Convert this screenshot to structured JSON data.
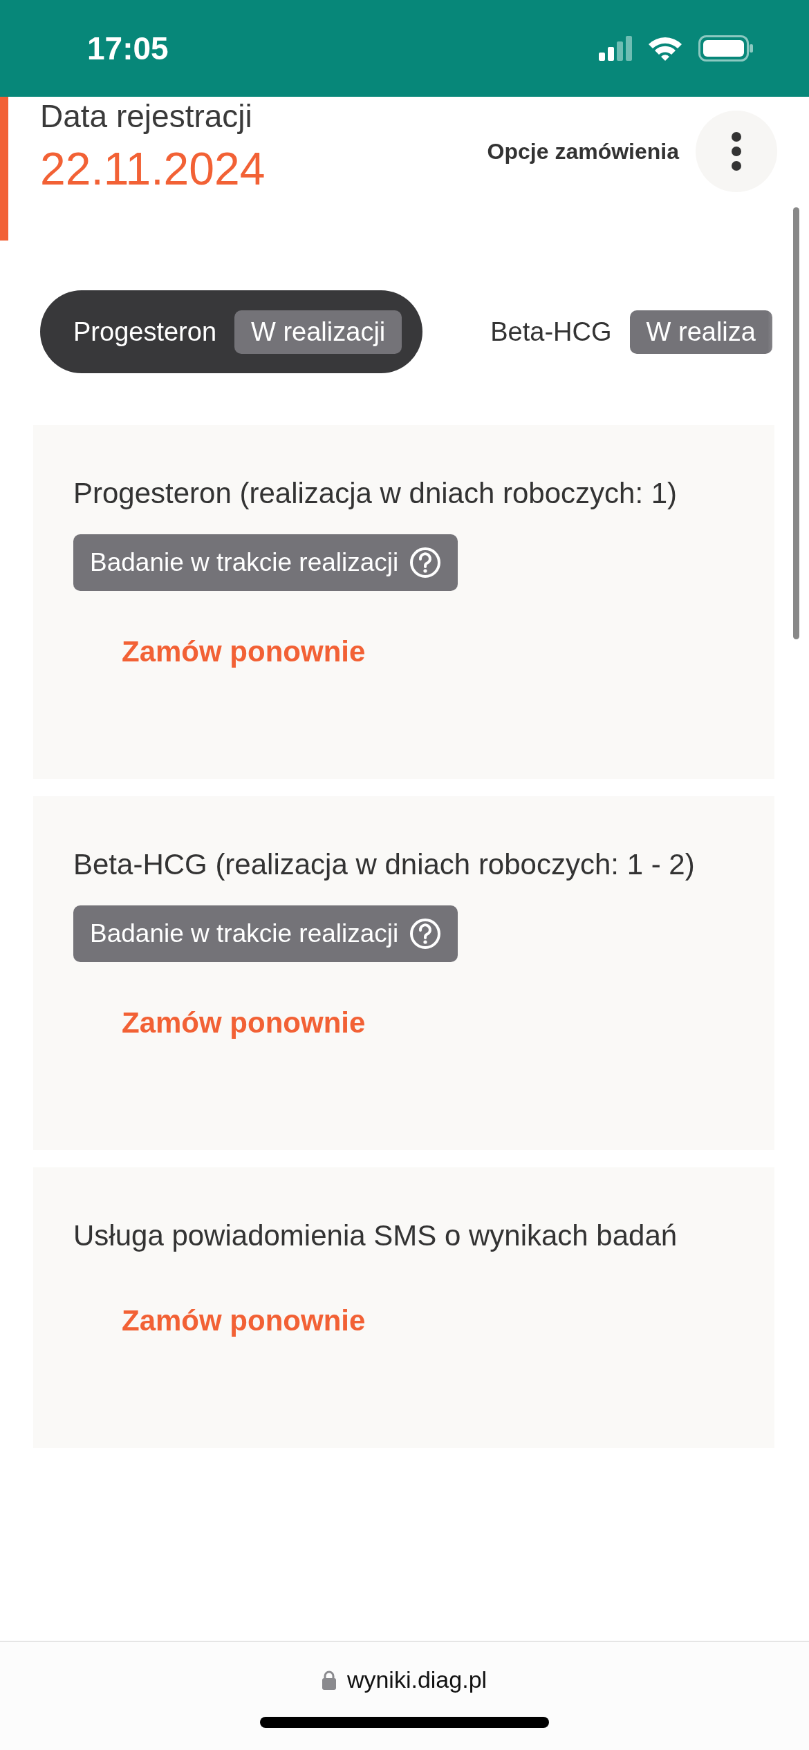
{
  "status_bar": {
    "time": "17:05"
  },
  "header": {
    "label": "Data rejestracji",
    "date": "22.11.2024",
    "options_label": "Opcje zamówienia"
  },
  "tabs": [
    {
      "name": "Progesteron",
      "status": "W realizacji",
      "selected": true
    },
    {
      "name": "Beta-HCG",
      "status": "W realiza",
      "selected": false
    }
  ],
  "tests": [
    {
      "title": "Progesteron (realizacja w dniach roboczych: 1)",
      "status": "Badanie w trakcie realizacji",
      "action": "Zamów ponownie"
    },
    {
      "title": "Beta-HCG (realizacja w dniach roboczych: 1 - 2)",
      "status": "Badanie w trakcie realizacji",
      "action": "Zamów ponownie"
    },
    {
      "title": "Usługa powiadomienia SMS o wynikach badań",
      "action": "Zamów ponownie"
    }
  ],
  "browser_bar": {
    "url": "wyniki.diag.pl"
  }
}
